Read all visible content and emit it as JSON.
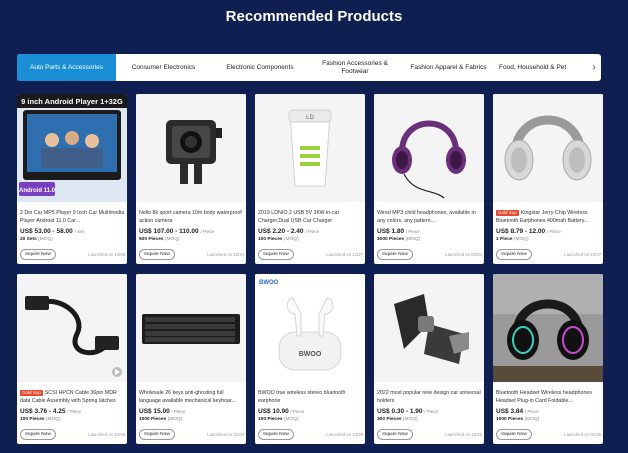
{
  "page_title": "Recommended Products",
  "tabs": [
    {
      "label": "Auto Parts & Accessories",
      "active": true
    },
    {
      "label": "Consumer Electronics",
      "active": false
    },
    {
      "label": "Electronic Components",
      "active": false
    },
    {
      "label": "Fashion Accessories & Footwear",
      "active": false
    },
    {
      "label": "Fashion Apparel & Fabrics",
      "active": false
    },
    {
      "label": "Food, Household & Pet",
      "active": false
    }
  ],
  "tab_next_icon": "chevron-right-icon",
  "colors": {
    "background": "#0f1f52",
    "active_tab": "#1a8fd6",
    "badge": "#e8462b"
  },
  "inquire_label": "Inquire Now",
  "unit_label": "/ Piece",
  "moq_label": "(MOQ)",
  "products": [
    {
      "title": "2 Din Car MP5 Player 9 Inch Car Multimedia Player Android 11.0 Car...",
      "badge": "",
      "price": "US$ 53.00 - 58.00",
      "unit": "/ Set",
      "moq": "20 Sets",
      "launched": "Launched on 12/08",
      "image_text": "9 inch Android Player 1+32G",
      "image_text2": "Android 11.0"
    },
    {
      "title": "Nello 8k sport camera 10m body waterproof action camera",
      "badge": "",
      "price": "US$ 107.00 - 110.00",
      "unit": "/ Piece",
      "moq": "500 Pieces",
      "launched": "Launched on 12/24"
    },
    {
      "title": "2019 LDNIO 2 USB 5V 36W in-car Charger,Dual USB Car Charger",
      "badge": "",
      "price": "US$ 2.20 - 2.40",
      "unit": "/ Piece",
      "moq": "100 Pieces",
      "launched": "Launched on 12/27"
    },
    {
      "title": "Wired MP3 child headphones, available in any colors, any pattern...",
      "badge": "",
      "price": "US$ 1.80",
      "unit": "/ Piece",
      "moq": "3000 Pieces",
      "launched": "Launched on 01/04"
    },
    {
      "title": "Kingstar Jerry Chip Wireless Bluetooth Earphones 400mah Battery...",
      "badge": "Gold Sup",
      "price": "US$ 8.79 - 12.00",
      "unit": "/ Piece",
      "moq": "1 Piece",
      "launched": "Launched on 12/27"
    },
    {
      "title": "SCSI HPCN Cable 36pin MDR data Cable Assembly with Spring latches",
      "badge": "Gold Sup",
      "price": "US$ 3.76 - 4.25",
      "unit": "/ Piece",
      "moq": "100 Pieces",
      "launched": "Launched on 12/08"
    },
    {
      "title": "Wholesale 26 keys anti-ghosting full language available mechanical keyboar...",
      "badge": "",
      "price": "US$ 15.00",
      "unit": "/ Piece",
      "moq": "1000 Pieces",
      "launched": "Launched on 01/04"
    },
    {
      "title": "BWOO true wireless stereo bluetooth earphone",
      "badge": "",
      "price": "US$ 10.90",
      "unit": "/ Piece",
      "moq": "100 Pieces",
      "launched": "Launched on 12/29",
      "image_text": "BWOO",
      "image_text2": "BWOO"
    },
    {
      "title": "2022 most popular new design car universal holders",
      "badge": "",
      "price": "US$ 0.30 - 1.90",
      "unit": "/ Piece",
      "moq": "300 Pieces",
      "launched": "Launched on 12/22"
    },
    {
      "title": "Bluetooth Headset Wireless headphones Headset Plug-in Card Foldable...",
      "badge": "",
      "price": "US$ 3.84",
      "unit": "/ Piece",
      "moq": "1000 Pieces",
      "launched": "Launched on 01/06"
    }
  ]
}
